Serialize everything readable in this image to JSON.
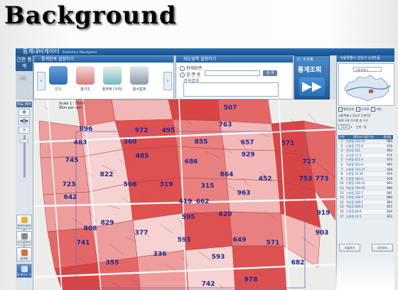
{
  "slide": {
    "title": "Background"
  },
  "app": {
    "brand_title": "통계내비게이터",
    "brand_sub": "Statistics Navigator",
    "logo_text": "간편 통계",
    "nav_panel": {
      "title": "통계항목 설정하기",
      "categories": [
        {
          "label": "인구"
        },
        {
          "label": "총가구"
        },
        {
          "label": "총주택 (거처)"
        },
        {
          "label": "총사업체"
        }
      ],
      "colors": [
        "#5a8fd4",
        "#c94f52",
        "#6fa9c8",
        "#8e99aa"
      ]
    },
    "setting_panel": {
      "title": "지도영역 설정하기",
      "option_1": "현재화면",
      "option_2": "읍·면·동",
      "result_label": "검색결과",
      "search_button": "검 색"
    },
    "stats_panel": {
      "head": "2 › 3 단계",
      "button": "통계조회",
      "arrow": "▶▶"
    },
    "tools": {
      "label": "지도 제어",
      "items": [
        "✥",
        "◀",
        "▶",
        "＋"
      ]
    },
    "side_buttons": [
      {
        "label": "통계조회하기",
        "color": "#e8b040"
      },
      {
        "label": "지도출력하기",
        "color": "#8a8a8a"
      },
      {
        "label": "범례창",
        "color": "#d86d3a"
      },
      {
        "label": "통계지도 작성",
        "color": "#3b6fb0"
      }
    ],
    "map": {
      "scale_line1": "Scale 1 : 5000",
      "scale_line2": "95m per unit",
      "labels": [
        {
          "t": "507"
        },
        {
          "t": "896"
        },
        {
          "t": "972"
        },
        {
          "t": "495"
        },
        {
          "t": "763"
        },
        {
          "t": "483"
        },
        {
          "t": "360"
        },
        {
          "t": "855"
        },
        {
          "t": "657"
        },
        {
          "t": "571"
        },
        {
          "t": "485"
        },
        {
          "t": "686"
        },
        {
          "t": "929"
        },
        {
          "t": "727"
        },
        {
          "t": "745"
        },
        {
          "t": "822"
        },
        {
          "t": "864"
        },
        {
          "t": "452"
        },
        {
          "t": "753"
        },
        {
          "t": "773"
        },
        {
          "t": "723"
        },
        {
          "t": "566"
        },
        {
          "t": "319"
        },
        {
          "t": "315"
        },
        {
          "t": "963"
        },
        {
          "t": "642"
        },
        {
          "t": "419"
        },
        {
          "t": "662"
        },
        {
          "t": "919"
        },
        {
          "t": "829"
        },
        {
          "t": "808"
        },
        {
          "t": "620"
        },
        {
          "t": "595"
        },
        {
          "t": "741"
        },
        {
          "t": "377"
        },
        {
          "t": "593"
        },
        {
          "t": "649"
        },
        {
          "t": "336"
        },
        {
          "t": "571"
        },
        {
          "t": "682"
        },
        {
          "t": "355"
        },
        {
          "t": "593"
        },
        {
          "t": "903"
        },
        {
          "t": "978"
        },
        {
          "t": "742"
        }
      ]
    },
    "right_panel": {
      "head": "서울특별시 강남구 논현1동",
      "minimap_field": "서울특별시",
      "checks": [
        "행정경계",
        "도로명",
        "지번"
      ],
      "line_1": "서울특별시 강남구 논현1동",
      "line_2": "통계 구분 주거용 총 가구",
      "year": "2010",
      "unit": "단위 : 명",
      "table_headers": [
        "순위",
        "행정코드(통)구분",
        "통계값"
      ],
      "rows": [
        {
          "r": "1",
          "n": "논현동 211-14",
          "v": "964"
        },
        {
          "r": "2",
          "n": "논현동 715-6",
          "v": "978"
        },
        {
          "r": "3",
          "n": "신사동 521",
          "v": "963"
        },
        {
          "r": "4",
          "n": "신사동 11-1",
          "v": "976"
        },
        {
          "r": "5",
          "n": "논현동 611-4",
          "v": "970"
        },
        {
          "r": "6",
          "n": "역삼동 823-4",
          "v": "969"
        },
        {
          "r": "7",
          "n": "논현동 733-37",
          "v": "936"
        },
        {
          "r": "8",
          "n": "논현동 35-10",
          "v": "929"
        },
        {
          "r": "9",
          "n": "논현동 163-4",
          "v": "919"
        },
        {
          "r": "10",
          "n": "논현동 239-15",
          "v": "903"
        },
        {
          "r": "11",
          "n": "역삼동 720-24",
          "v": "896"
        },
        {
          "r": "12",
          "n": "논현동 232-7",
          "v": "891"
        },
        {
          "r": "13",
          "n": "논현동 242-7",
          "v": "880"
        },
        {
          "r": "14",
          "n": "역삼동 649-1",
          "v": "864"
        },
        {
          "r": "15",
          "n": "역삼동 829-2",
          "v": "855"
        },
        {
          "r": "16",
          "n": "논현동 60-9",
          "v": "829"
        },
        {
          "r": "17",
          "n": "논현동 41-1",
          "v": "822"
        }
      ],
      "btn_1": "추출하기",
      "btn_2": "다운로드"
    }
  }
}
